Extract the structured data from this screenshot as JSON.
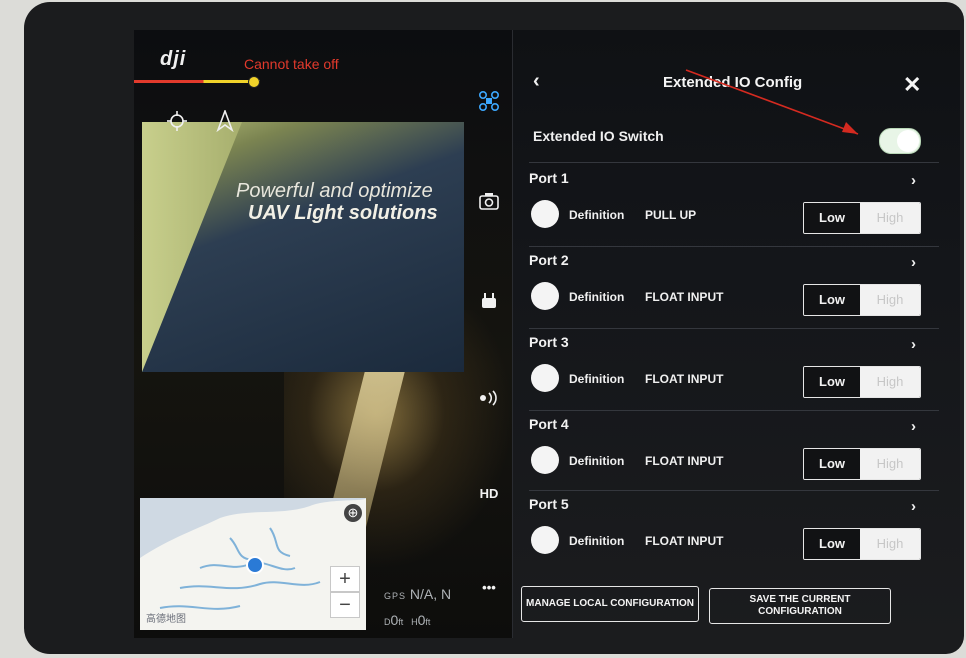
{
  "status": {
    "logo": "dji",
    "takeoff_text": "Cannot take off",
    "bar_colors": [
      "#e23a2c",
      "#f0d22a"
    ]
  },
  "camera": {
    "poster_line1": "Powerful and optimize",
    "poster_line2": "UAV Light solutions"
  },
  "map": {
    "zoom_in": "+",
    "zoom_out": "−",
    "credit": "高德地图"
  },
  "telemetry": {
    "gps_label": "GPS",
    "gps_value": "N/A, N",
    "d_label": "D",
    "d_value": "0",
    "d_unit": "ft",
    "h_label": "H",
    "h_value": "0",
    "h_unit": "ft"
  },
  "toolbar": {
    "items": [
      "aircraft-icon",
      "camera-icon",
      "remote-icon",
      "signal-icon",
      "HD",
      "more-icon"
    ],
    "hd_label": "HD",
    "more_label": "•••"
  },
  "panel": {
    "title": "Extended IO Config",
    "back": "‹",
    "close": "✕",
    "switch_label": "Extended IO Switch",
    "switch_on": true,
    "ports": [
      {
        "title": "Port 1",
        "def_label": "Definition",
        "def_value": "PULL UP",
        "low": "Low",
        "high": "High",
        "selected": "Low"
      },
      {
        "title": "Port 2",
        "def_label": "Definition",
        "def_value": "FLOAT INPUT",
        "low": "Low",
        "high": "High",
        "selected": "Low"
      },
      {
        "title": "Port 3",
        "def_label": "Definition",
        "def_value": "FLOAT INPUT",
        "low": "Low",
        "high": "High",
        "selected": "Low"
      },
      {
        "title": "Port 4",
        "def_label": "Definition",
        "def_value": "FLOAT INPUT",
        "low": "Low",
        "high": "High",
        "selected": "Low"
      },
      {
        "title": "Port 5",
        "def_label": "Definition",
        "def_value": "FLOAT INPUT",
        "low": "Low",
        "high": "High",
        "selected": "Low"
      }
    ],
    "manage_label": "MANAGE LOCAL CONFIGURATION",
    "save_label_1": "SAVE THE CURRENT",
    "save_label_2": "CONFIGURATION"
  },
  "colors": {
    "accent_red": "#e23a2c",
    "accent_yellow": "#f0d22a",
    "switch_on": "#e8f5e7",
    "map_location": "#2a7ad6"
  }
}
